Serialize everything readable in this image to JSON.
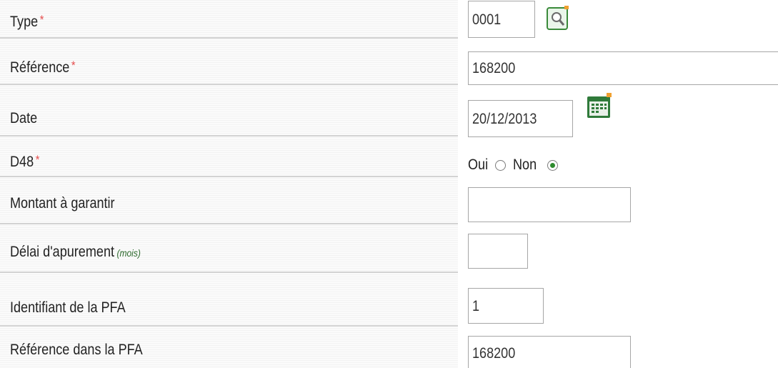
{
  "fields": {
    "type": {
      "label": "Type",
      "required_mark": "*",
      "value": "0001"
    },
    "reference": {
      "label": "Référence",
      "required_mark": "*",
      "value": "168200"
    },
    "date": {
      "label": "Date",
      "value": "20/12/2013"
    },
    "d48": {
      "label": "D48",
      "required_mark": "*",
      "options": [
        {
          "label": "Oui",
          "checked": false
        },
        {
          "label": "Non",
          "checked": true
        }
      ]
    },
    "montant": {
      "label": "Montant à garantir",
      "value": ""
    },
    "delai": {
      "label": "Délai d'apurement",
      "hint": "(mois)",
      "value": ""
    },
    "identifiant_pfa": {
      "label": "Identifiant de la PFA",
      "value": "1"
    },
    "reference_pfa": {
      "label": "Référence dans la PFA",
      "value": "168200"
    }
  },
  "icons": {
    "lookup": "search-lookup-icon",
    "calendar": "calendar-icon"
  },
  "colors": {
    "required": "#e54d4d",
    "hint": "#2d6a2d",
    "radio_checked": "#2e8b2e",
    "icon_green": "#3a8a3a"
  }
}
